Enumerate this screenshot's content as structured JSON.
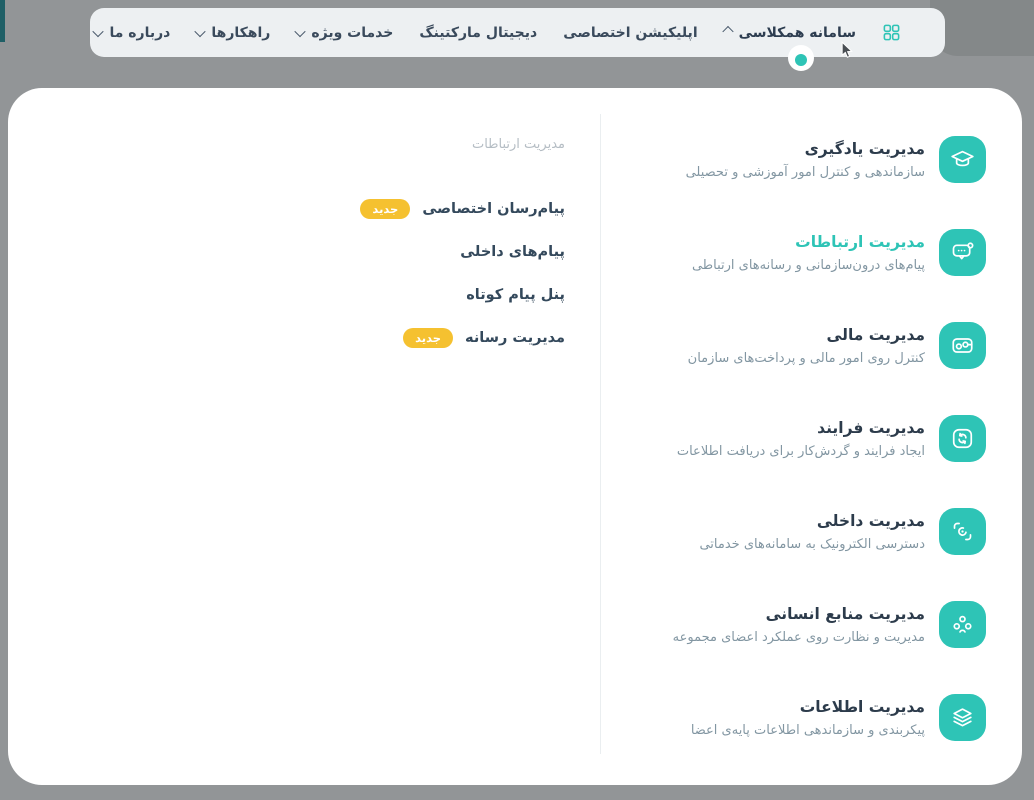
{
  "nav": {
    "items": [
      {
        "label": "سامانه همکلاسی",
        "chevron": "up",
        "active": true
      },
      {
        "label": "اپلیکیشن اختصاصی",
        "chevron": null,
        "active": false
      },
      {
        "label": "دیجیتال مارکتینگ",
        "chevron": null,
        "active": false
      },
      {
        "label": "خدمات ویژه",
        "chevron": "down",
        "active": false
      },
      {
        "label": "راهکارها",
        "chevron": "down",
        "active": false
      },
      {
        "label": "درباره ما",
        "chevron": "down",
        "active": false
      }
    ]
  },
  "megamenu": {
    "categories": [
      {
        "title": "مدیریت یادگیری",
        "subtitle": "سازماندهی و کنترل امور آموزشی و تحصیلی",
        "icon": "graduation-cap",
        "active": false
      },
      {
        "title": "مدیریت ارتباطات",
        "subtitle": "پیام‌های درون‌سازمانی و رسانه‌های ارتباطی",
        "icon": "chat",
        "active": true
      },
      {
        "title": "مدیریت مالی",
        "subtitle": "کنترل روی امور مالی و پرداخت‌های سازمان",
        "icon": "wallet",
        "active": false
      },
      {
        "title": "مدیریت فرایند",
        "subtitle": "ایجاد فرایند و گردش‌کار برای دریافت اطلاعات",
        "icon": "sync",
        "active": false
      },
      {
        "title": "مدیریت داخلی",
        "subtitle": "دسترسی الکترونیک به سامانه‌های خدماتی",
        "icon": "face-scan",
        "active": false
      },
      {
        "title": "مدیریت منابع انسانی",
        "subtitle": "مدیریت و نظارت روی عملکرد اعضای مجموعه",
        "icon": "people",
        "active": false
      },
      {
        "title": "مدیریت اطلاعات",
        "subtitle": "پیکربندی و سازماندهی اطلاعات پایه‌ی اعضا",
        "icon": "layers",
        "active": false
      }
    ],
    "submenu": {
      "header": "مدیریت ارتباطات",
      "items": [
        {
          "label": "پیام‌رسان اختصاصی",
          "badge": "جدید"
        },
        {
          "label": "پیام‌های داخلی",
          "badge": null
        },
        {
          "label": "پنل پیام کوتاه",
          "badge": null
        },
        {
          "label": "مدیریت رسانه",
          "badge": "جدید"
        }
      ]
    }
  },
  "colors": {
    "accent_teal": "#2ec4b6",
    "badge_yellow": "#f5c130",
    "text_navy": "#2c3b4b",
    "subtitle_gray": "#8296a2"
  }
}
